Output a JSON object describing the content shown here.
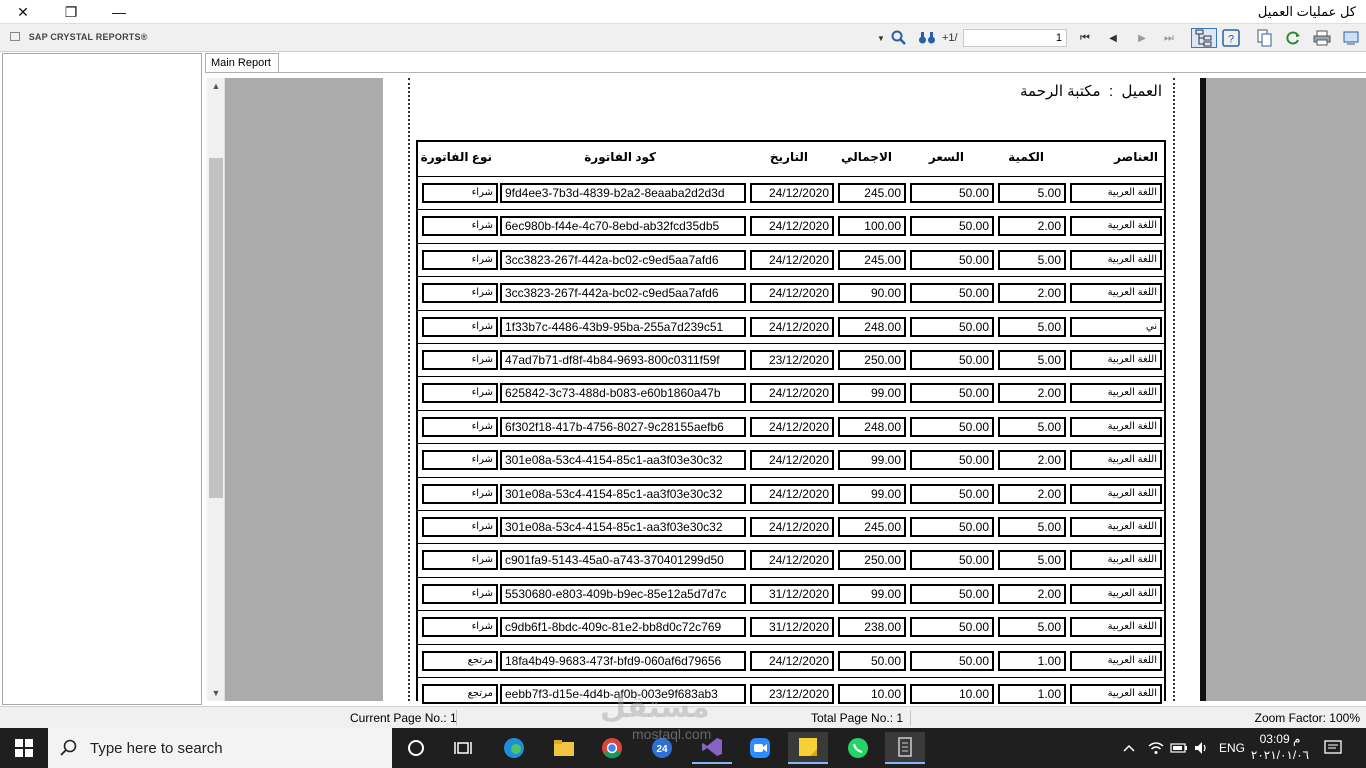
{
  "window": {
    "title": "كل عمليات العميل"
  },
  "toolbar": {
    "brand": "SAP CRYSTAL REPORTS®",
    "page_nav_label": "+1/",
    "page_value": "1"
  },
  "tabs": {
    "main_report": "Main Report"
  },
  "report": {
    "customer_label": "العميل",
    "customer_separator": ":",
    "customer_name": "مكتبة الرحمة",
    "headers": {
      "item": "العناصر",
      "qty": "الكمية",
      "price": "السعر",
      "total": "الاجمالي",
      "date": "التاريخ",
      "code": "كود الفاتورة",
      "type": "نوع الفاتورة"
    },
    "rows": [
      {
        "item": "اللغة العربية",
        "qty": "5.00",
        "price": "50.00",
        "total": "245.00",
        "date": "24/12/2020",
        "code": "9fd4ee3-7b3d-4839-b2a2-8eaaba2d2d3d",
        "type": "شراء"
      },
      {
        "item": "اللغة العربية",
        "qty": "2.00",
        "price": "50.00",
        "total": "100.00",
        "date": "24/12/2020",
        "code": "6ec980b-f44e-4c70-8ebd-ab32fcd35db5",
        "type": "شراء"
      },
      {
        "item": "اللغة العربية",
        "qty": "5.00",
        "price": "50.00",
        "total": "245.00",
        "date": "24/12/2020",
        "code": "3cc3823-267f-442a-bc02-c9ed5aa7afd6",
        "type": "شراء"
      },
      {
        "item": "اللغة العربية",
        "qty": "2.00",
        "price": "50.00",
        "total": "90.00",
        "date": "24/12/2020",
        "code": "3cc3823-267f-442a-bc02-c9ed5aa7afd6",
        "type": "شراء"
      },
      {
        "item": "ني",
        "qty": "5.00",
        "price": "50.00",
        "total": "248.00",
        "date": "24/12/2020",
        "code": "1f33b7c-4486-43b9-95ba-255a7d239c51",
        "type": "شراء"
      },
      {
        "item": "اللغة العربية",
        "qty": "5.00",
        "price": "50.00",
        "total": "250.00",
        "date": "23/12/2020",
        "code": "47ad7b71-df8f-4b84-9693-800c0311f59f",
        "type": "شراء"
      },
      {
        "item": "اللغة العربية",
        "qty": "2.00",
        "price": "50.00",
        "total": "99.00",
        "date": "24/12/2020",
        "code": "625842-3c73-488d-b083-e60b1860a47b",
        "type": "شراء"
      },
      {
        "item": "اللغة العربية",
        "qty": "5.00",
        "price": "50.00",
        "total": "248.00",
        "date": "24/12/2020",
        "code": "6f302f18-417b-4756-8027-9c28155aefb6",
        "type": "شراء"
      },
      {
        "item": "اللغة العربية",
        "qty": "2.00",
        "price": "50.00",
        "total": "99.00",
        "date": "24/12/2020",
        "code": "301e08a-53c4-4154-85c1-aa3f03e30c32",
        "type": "شراء"
      },
      {
        "item": "اللغة العربية",
        "qty": "2.00",
        "price": "50.00",
        "total": "99.00",
        "date": "24/12/2020",
        "code": "301e08a-53c4-4154-85c1-aa3f03e30c32",
        "type": "شراء"
      },
      {
        "item": "اللغة العربية",
        "qty": "5.00",
        "price": "50.00",
        "total": "245.00",
        "date": "24/12/2020",
        "code": "301e08a-53c4-4154-85c1-aa3f03e30c32",
        "type": "شراء"
      },
      {
        "item": "اللغة العربية",
        "qty": "5.00",
        "price": "50.00",
        "total": "250.00",
        "date": "24/12/2020",
        "code": "c901fa9-5143-45a0-a743-370401299d50",
        "type": "شراء"
      },
      {
        "item": "اللغة العربية",
        "qty": "2.00",
        "price": "50.00",
        "total": "99.00",
        "date": "31/12/2020",
        "code": "5530680-e803-409b-b9ec-85e12a5d7d7c",
        "type": "شراء"
      },
      {
        "item": "اللغة العربية",
        "qty": "5.00",
        "price": "50.00",
        "total": "238.00",
        "date": "31/12/2020",
        "code": "c9db6f1-8bdc-409c-81e2-bb8d0c72c769",
        "type": "شراء"
      },
      {
        "item": "اللغة العربية",
        "qty": "1.00",
        "price": "50.00",
        "total": "50.00",
        "date": "24/12/2020",
        "code": "18fa4b49-9683-473f-bfd9-060af6d79656",
        "type": "مرتجع"
      },
      {
        "item": "اللغة العربية",
        "qty": "1.00",
        "price": "10.00",
        "total": "10.00",
        "date": "23/12/2020",
        "code": "eebb7f3-d15e-4d4b-af0b-003e9f683ab3",
        "type": "مرتجع"
      }
    ]
  },
  "status": {
    "current_page": "Current Page No.: 1",
    "total_page": "Total Page No.: 1",
    "zoom": "Zoom Factor: 100%"
  },
  "watermark": {
    "logo": "مستقل",
    "site": "mostaql.com"
  },
  "taskbar": {
    "search_placeholder": "Type here to search",
    "lang": "ENG",
    "time": "03:09 م",
    "date": "٢٠٢١/٠١/٠٦",
    "badge": "24"
  }
}
